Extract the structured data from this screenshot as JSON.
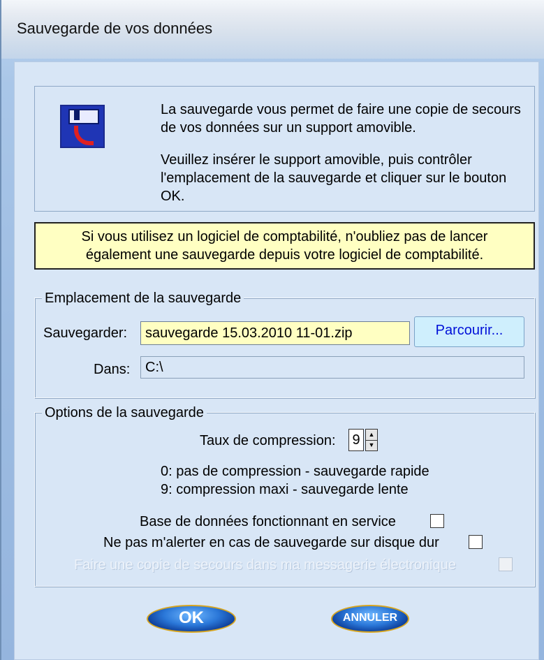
{
  "window": {
    "title": "Sauvegarde de vos données"
  },
  "info": {
    "paragraph1": "La sauvegarde vous permet de faire une copie de secours de vos données sur un support amovible.",
    "paragraph2": "Veuillez insérer le support amovible, puis contrôler l'emplacement de la sauvegarde et cliquer sur le bouton OK.",
    "icon": "floppy-disk-save-icon"
  },
  "warning": {
    "line1": "Si vous utilisez un logiciel de comptabilité, n'oubliez pas de lancer",
    "line2": "également une sauvegarde depuis votre logiciel de comptabilité."
  },
  "location": {
    "legend": "Emplacement de la sauvegarde",
    "save_label": "Sauvegarder:",
    "save_value": "sauvegarde 15.03.2010 11-01.zip",
    "browse_label": "Parcourir...",
    "in_label": "Dans:",
    "in_value": "C:\\"
  },
  "options": {
    "legend": "Options de la sauvegarde",
    "compression_label": "Taux de compression:",
    "compression_value": "9",
    "hint0": "0: pas de compression - sauvegarde rapide",
    "hint9": "9: compression maxi - sauvegarde lente",
    "service_label": "Base de données fonctionnant en service",
    "no_alert_label": "Ne pas m'alerter en cas de sauvegarde sur disque dur",
    "email_copy_label": "Faire une copie de secours dans ma messagerie électronique"
  },
  "buttons": {
    "ok": "OK",
    "cancel": "ANNULER"
  },
  "colors": {
    "info_bg": "#d8e6f6",
    "warning_bg": "#ffffc2",
    "browse_text": "#0010d8"
  }
}
